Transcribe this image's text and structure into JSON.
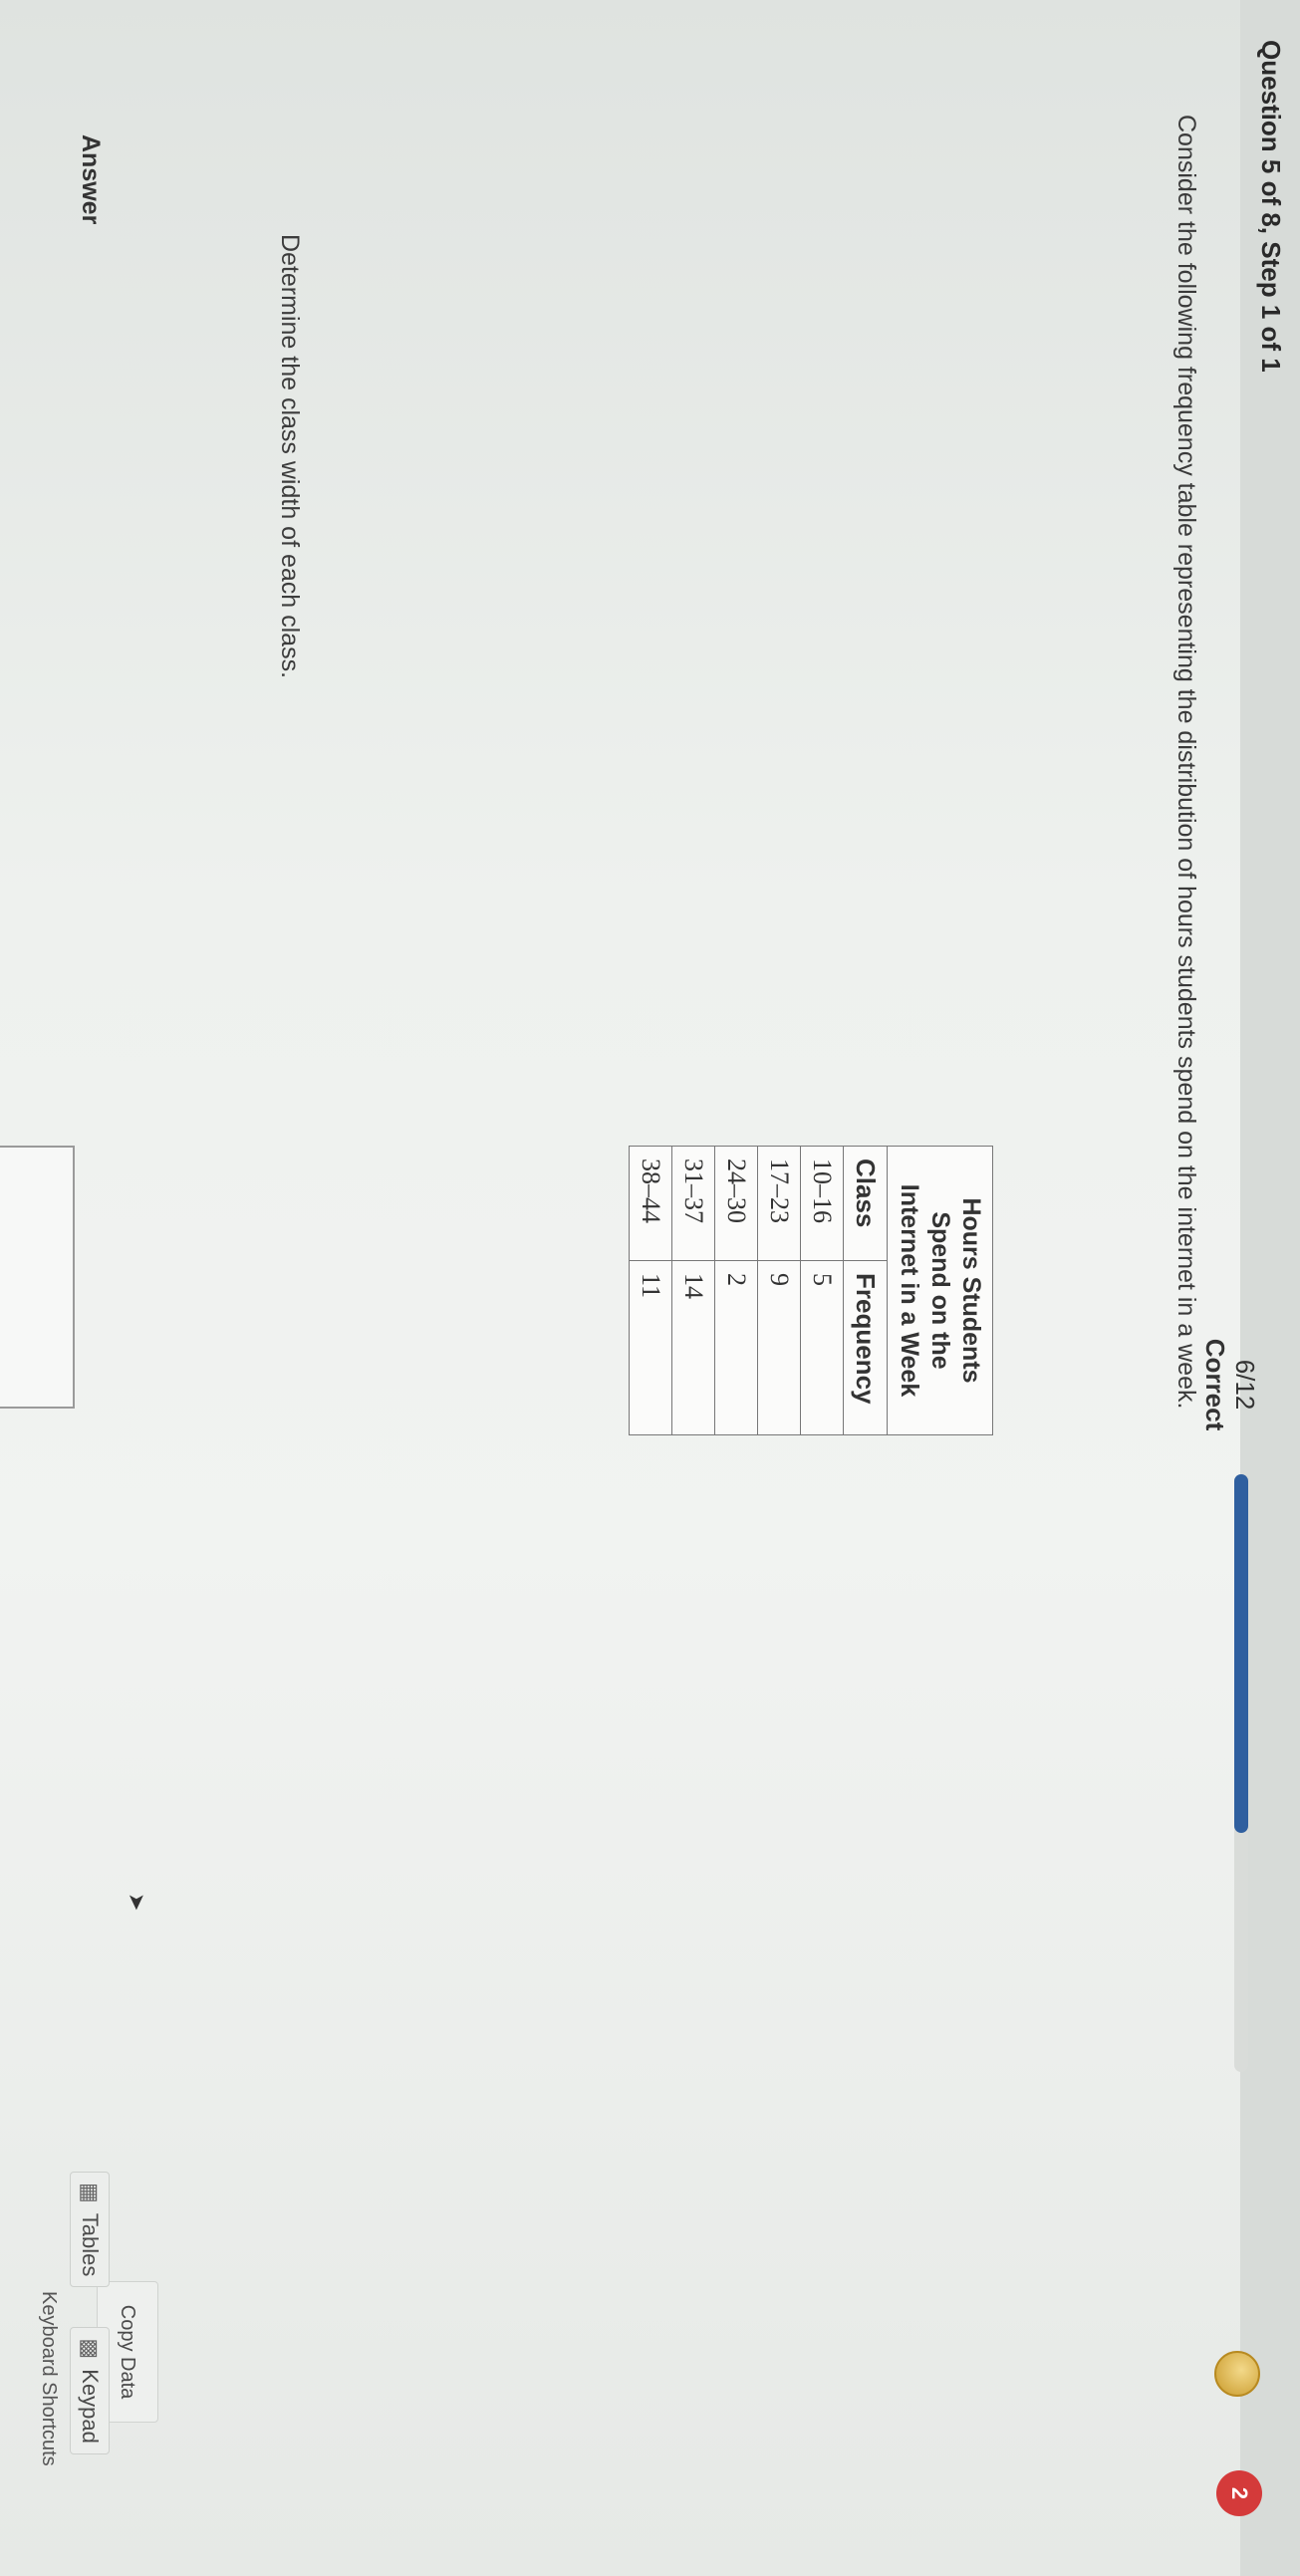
{
  "header": {
    "question_title": "Question 5 of 8, Step 1 of 1",
    "score": "6/12",
    "status": "Correct",
    "progress": 0.6,
    "streak_count": "2",
    "progress_color": "#2f5f9f"
  },
  "prompt": "Consider the following frequency table representing the distribution of hours students spend on the internet in a week.",
  "table": {
    "caption_lines": [
      "Hours Students",
      "Spend on the",
      "Internet in a Week"
    ],
    "headers": [
      "Class",
      "Frequency"
    ],
    "rows": [
      [
        "10–16",
        "5"
      ],
      [
        "17–23",
        "9"
      ],
      [
        "24–30",
        "2"
      ],
      [
        "31–37",
        "14"
      ],
      [
        "38–44",
        "11"
      ]
    ]
  },
  "copy_data_label": "Copy Data",
  "instruction": "Determine the class width of each class.",
  "answer_label": "Answer",
  "tools": {
    "tables_label": "Tables",
    "keypad_label": "Keypad",
    "shortcuts_label": "Keyboard Shortcuts"
  },
  "icons": {
    "tables": "table-grid-icon",
    "keypad": "keypad-icon",
    "coin": "coin-icon",
    "streak": "streak-heart-icon",
    "cursor": "mouse-cursor-icon"
  }
}
